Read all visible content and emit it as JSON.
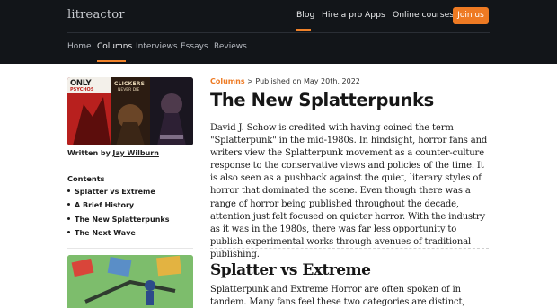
{
  "header": {
    "logo": "litreactor",
    "nav": [
      "Blog",
      "Hire a pro",
      "Apps",
      "Online courses"
    ],
    "join_label": "Join us",
    "subnav": [
      "Home",
      "Columns",
      "Interviews",
      "Essays",
      "Reviews"
    ]
  },
  "sidebar": {
    "author_prefix": "Written by",
    "author_name": "Jay Wilburn",
    "contents_title": "Contents",
    "toc": [
      "Splatter vs Extreme",
      "A Brief History",
      "The New Splatterpunks",
      "The Next Wave"
    ],
    "cover_texts": [
      "ONLY",
      "PSYCHOS",
      "CLICKERS",
      "NEVER DIE"
    ]
  },
  "article": {
    "breadcrumb_link": "Columns",
    "breadcrumb_rest": " > Published on May 20th, 2022",
    "title": "The New Splatterpunks",
    "paragraph1": "David J. Schow is credited with having coined the term \"Splatterpunk\" in the mid-1980s. In hindsight, horror fans and writers view the Splatterpunk movement as a counter-culture response to the conservative views and policies of the time. It is also seen as a pushback against the quiet, literary styles of horror that dominated the scene. Even though there was a range of horror being published throughout the decade, attention just felt focused on quieter horror. With the industry as it was in the 1980s, there was far less opportunity to publish experimental works through avenues of traditional publishing.",
    "section_title": "Splatter vs Extreme",
    "paragraph2": "Splatterpunk and Extreme Horror are often spoken of in tandem. Many fans feel these two categories are distinct, however. How they are defined"
  },
  "colors": {
    "accent": "#ee7a23",
    "header_bg": "#121519"
  }
}
